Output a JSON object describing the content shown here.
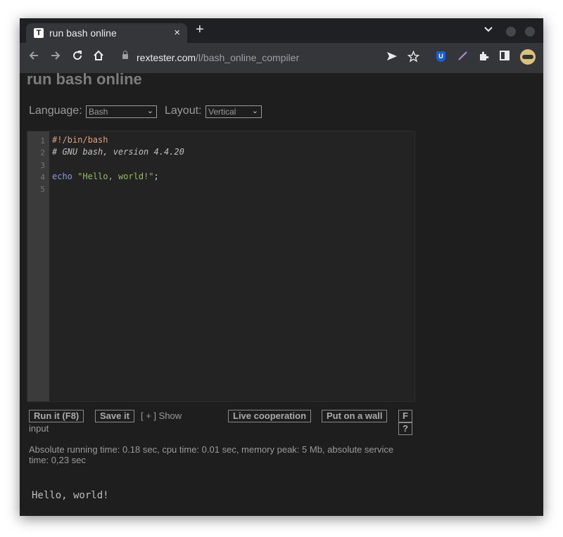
{
  "browser": {
    "tab_title": "run bash online",
    "tab_favicon": "T",
    "close_glyph": "×",
    "new_tab_glyph": "+",
    "url_host": "rextester.com",
    "url_path": "/l/bash_online_compiler"
  },
  "page": {
    "title": "run bash online",
    "language_label": "Language:",
    "language_value": "Bash",
    "layout_label": "Layout:",
    "layout_value": "Vertical"
  },
  "editor": {
    "line_numbers": [
      "1",
      "2",
      "3",
      "4",
      "5"
    ],
    "line1": "#!/bin/bash",
    "line2": "# GNU bash, version 4.4.20",
    "line4_keyword": "echo",
    "line4_string": "\"Hello, world!\"",
    "line4_end": ";"
  },
  "controls": {
    "run_label": "Run it (F8)",
    "save_label": "Save it",
    "show_input_prefix": "[ + ] Show",
    "show_input_suffix": "input",
    "live_coop_label": "Live cooperation",
    "wall_label": "Put on a wall",
    "f_label": "F",
    "help_label": "?"
  },
  "stats": {
    "line1": "Absolute running time: 0.18 sec, cpu time: 0.01 sec, memory peak: 5 Mb, absolute service",
    "line2": "time: 0,23 sec"
  },
  "output": "Hello, world!",
  "colors": {
    "page_bg": "#1e1e1e",
    "chrome_bg": "#35363a",
    "bitwarden": "#175ddc"
  }
}
